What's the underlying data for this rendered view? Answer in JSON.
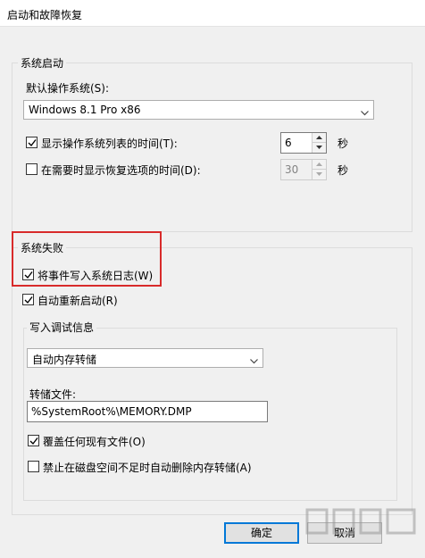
{
  "window": {
    "title": "启动和故障恢复"
  },
  "system_startup": {
    "legend": "系统启动",
    "default_os_label": "默认操作系统(S):",
    "default_os_value": "Windows 8.1 Pro x86",
    "show_os_list": {
      "label": "显示操作系统列表的时间(T):",
      "checked": true,
      "value": "6",
      "unit": "秒"
    },
    "show_recovery": {
      "label": "在需要时显示恢复选项的时间(D):",
      "checked": false,
      "value": "30",
      "unit": "秒"
    }
  },
  "system_failure": {
    "legend": "系统失败",
    "write_event_log": {
      "label": "将事件写入系统日志(W)",
      "checked": true
    },
    "auto_restart": {
      "label": "自动重新启动(R)",
      "checked": true
    },
    "debug_info": {
      "legend": "写入调试信息",
      "dump_type": "自动内存转储",
      "dump_file_label": "转储文件:",
      "dump_file_value": "%SystemRoot%\\MEMORY.DMP",
      "overwrite": {
        "label": "覆盖任何现有文件(O)",
        "checked": true
      },
      "disable_auto_delete": {
        "label": "禁止在磁盘空间不足时自动删除内存转储(A)",
        "checked": false
      }
    }
  },
  "buttons": {
    "ok": "确定",
    "cancel": "取消"
  },
  "watermark": {
    "text": "下载吧"
  },
  "colors": {
    "highlight_box": "#d82a2a",
    "default_button_border": "#0078d7"
  }
}
